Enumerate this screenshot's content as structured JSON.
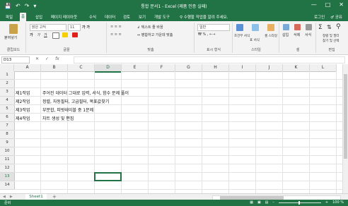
{
  "window": {
    "title": "통합 문서1 - Excel (제품 인증 실패)",
    "qat_icons": [
      "save-icon",
      "undo-icon",
      "redo-icon",
      "customize-icon"
    ],
    "controls": [
      "minimize",
      "restore",
      "close"
    ]
  },
  "tabs": {
    "items": [
      "파일",
      "홈",
      "삽입",
      "페이지 레이아웃",
      "수식",
      "데이터",
      "검토",
      "보기",
      "개발 도구"
    ],
    "active": "홈",
    "tell_me": "수행할 작업을 알려 주세요.",
    "signin": "로그인",
    "share": "공유"
  },
  "ribbon": {
    "clipboard": {
      "paste": "붙여넣기",
      "label": "클립보드"
    },
    "font": {
      "name": "맑은 고딕",
      "size": "11",
      "label": "글꼴"
    },
    "alignment": {
      "wrap": "텍스트 줄 바꿈",
      "merge": "병합하고 가운데 맞춤",
      "label": "맞춤"
    },
    "number": {
      "format": "일반",
      "label": "표시 형식"
    },
    "styles": {
      "conditional": "조건부 서식",
      "table": "표 서식",
      "cell": "셀 스타일",
      "label": "스타일"
    },
    "cells": {
      "insert": "삽입",
      "delete": "삭제",
      "format": "서식",
      "label": "셀"
    },
    "editing": {
      "sort": "정렬 및 필터",
      "find": "찾기 및 선택",
      "label": "편집"
    }
  },
  "formula_bar": {
    "name_box": "D13",
    "fx": "fx",
    "value": ""
  },
  "columns": [
    "A",
    "B",
    "C",
    "D",
    "E",
    "F",
    "G",
    "H",
    "I",
    "J",
    "K",
    "L"
  ],
  "rows": [
    "1",
    "2",
    "3",
    "4",
    "5",
    "6",
    "7",
    "8",
    "9",
    "10",
    "11",
    "12",
    "13",
    "14"
  ],
  "cells": [
    {
      "row": "3",
      "a": "제1작업",
      "b": "주어진 데이터 그대로 입력, 서식, 함수 문제 풀이"
    },
    {
      "row": "4",
      "a": "제2작업",
      "b": "정렬, 자동필터, 고급필터, 목표값찾기"
    },
    {
      "row": "5",
      "a": "제3작업",
      "b": "부분합, 피벗테이블 중 1문제"
    },
    {
      "row": "6",
      "a": "제4작업",
      "b": "차트 생성 및 편집"
    }
  ],
  "active_cell": "D13",
  "sheet": {
    "name": "Sheet1",
    "add": "+"
  },
  "status": {
    "ready": "준비",
    "zoom": "100 %"
  }
}
